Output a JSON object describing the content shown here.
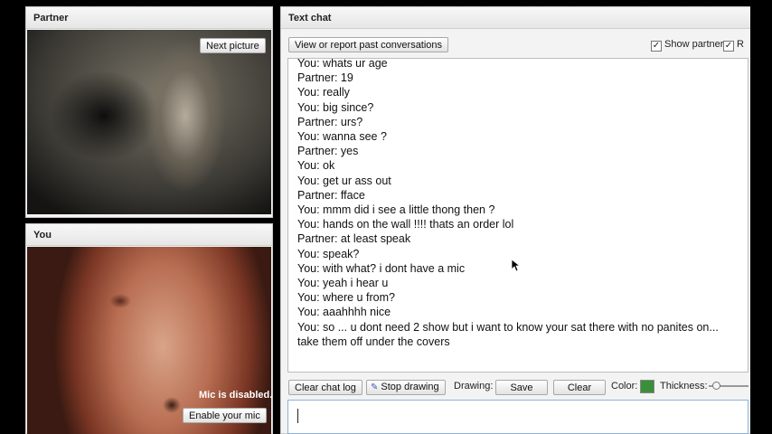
{
  "partner_panel": {
    "title": "Partner",
    "next_picture_label": "Next picture"
  },
  "you_panel": {
    "title": "You",
    "mic_status": "Mic is disabled.",
    "enable_mic_label": "Enable your mic"
  },
  "text_chat": {
    "title": "Text chat",
    "report_button_label": "View or report past conversations",
    "show_partner_label": "Show partner",
    "second_checkbox_label": "R",
    "messages": [
      "You: whats ur age",
      "Partner: 19",
      "You: really",
      "You: big since?",
      "Partner: urs?",
      "You: wanna see ?",
      "Partner: yes",
      "You: ok",
      "You: get ur ass out",
      "Partner: fface",
      "You: mmm did i see a little thong then ?",
      "You: hands on the wall !!!! thats an order lol",
      "Partner: at least speak",
      "You: speak?",
      "You: with what? i dont have a mic",
      "You: yeah i hear u",
      "You: where u from?",
      "You: aaahhhh nice",
      "You: so ... u dont need 2 show but i want to know your sat there with no panites on...",
      "take them off under the covers"
    ],
    "toolbar": {
      "clear_chat_log_label": "Clear chat log",
      "stop_drawing_label": "Stop drawing",
      "drawing_label": "Drawing:",
      "save_label": "Save",
      "clear_label": "Clear",
      "color_label": "Color:",
      "thickness_label": "Thickness:",
      "color_value": "#3a8f3a"
    },
    "input_value": ""
  }
}
